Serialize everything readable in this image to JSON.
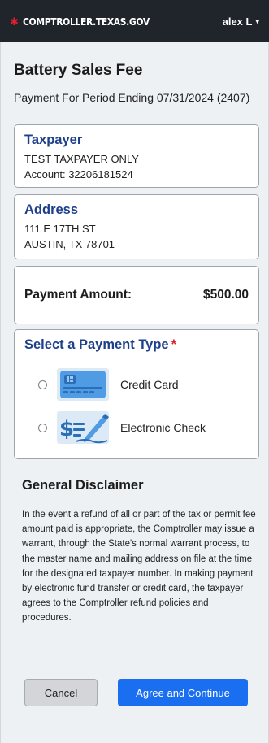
{
  "header": {
    "brand": "COMPTROLLER.TEXAS.GOV",
    "brand_icon": "star-icon",
    "user": "alex L",
    "user_caret": "▾"
  },
  "page": {
    "title": "Battery Sales Fee",
    "subtitle": "Payment For Period Ending 07/31/2024 (2407)"
  },
  "taxpayer": {
    "heading": "Taxpayer",
    "name": "TEST TAXPAYER ONLY",
    "account": "Account: 32206181524"
  },
  "address": {
    "heading": "Address",
    "line1": "111 E 17TH ST",
    "line2": "AUSTIN, TX 78701"
  },
  "payment": {
    "label": "Payment Amount:",
    "value": "$500.00"
  },
  "payment_type": {
    "heading": "Select a Payment Type",
    "required_mark": "*",
    "options": [
      {
        "label": "Credit Card",
        "icon": "credit-card-icon",
        "selected": false
      },
      {
        "label": "Electronic Check",
        "icon": "electronic-check-icon",
        "selected": false
      }
    ]
  },
  "disclaimer": {
    "heading": "General Disclaimer",
    "text": "In the event a refund of all or part of the tax or permit fee amount paid is appropriate, the Comptroller may issue a warrant, through the State's normal warrant process, to the master name and mailing address on file at the time for the designated taxpayer number. In making payment by electronic fund transfer or credit card, the taxpayer agrees to the Comptroller refund policies and procedures."
  },
  "actions": {
    "cancel": "Cancel",
    "agree": "Agree and Continue"
  },
  "colors": {
    "header_bg": "#20242b",
    "accent_blue": "#1a6ff0",
    "heading_blue": "#1e3f8a",
    "required_red": "#d21f2d"
  }
}
